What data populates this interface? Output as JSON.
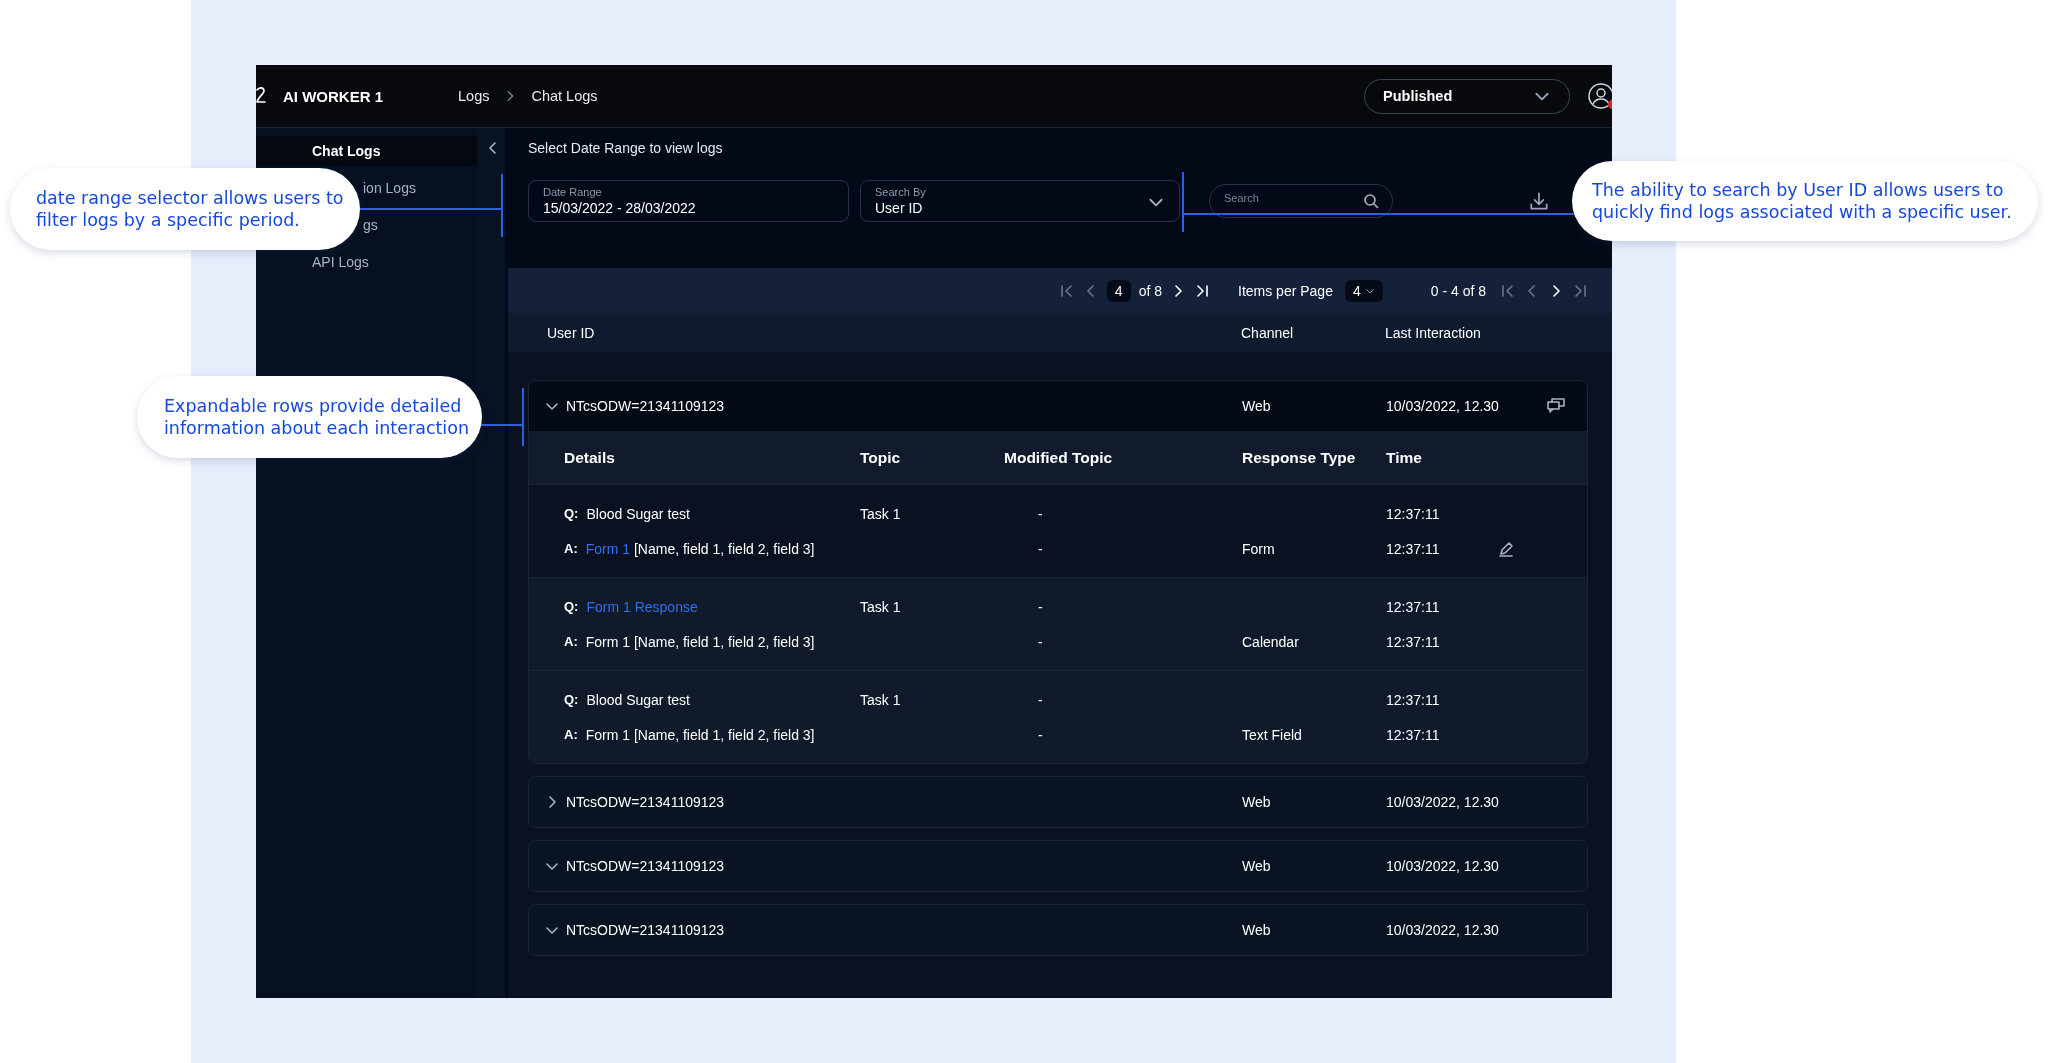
{
  "app": {
    "title": "AI WORKER 1",
    "breadcrumb": [
      "Logs",
      "Chat Logs"
    ],
    "status": "Published"
  },
  "sidebar": {
    "items": [
      {
        "label": "Chat Logs",
        "selected": true,
        "kind": "item"
      },
      {
        "label": "ion Logs",
        "selected": false,
        "kind": "cut"
      },
      {
        "label": "gs",
        "selected": false,
        "kind": "cut"
      },
      {
        "label": "API Logs",
        "selected": false,
        "kind": "item"
      }
    ]
  },
  "filters": {
    "heading": "Select Date Range to view logs",
    "date_range": {
      "label": "Date Range",
      "value": "15/03/2022 - 28/03/2022"
    },
    "search_by": {
      "label": "Search By",
      "value": "User ID"
    },
    "search": {
      "placeholder": "Search"
    }
  },
  "pagination": {
    "page": "4",
    "of": "of 8",
    "items_label": "Items per Page",
    "items_value": "4",
    "range": "0 - 4 of 8"
  },
  "table": {
    "columns": [
      "User ID",
      "Channel",
      "Last Interaction"
    ],
    "detail_columns": [
      "Details",
      "Topic",
      "Modified Topic",
      "Response Type",
      "Time"
    ],
    "rows": [
      {
        "user_id": "NTcsODW=21341109123",
        "channel": "Web",
        "last_interaction": "10/03/2022, 12.30",
        "expanded": true,
        "chat_icon": true,
        "groups": [
          {
            "selected": true,
            "lines": [
              {
                "label": "Q:",
                "parts": [
                  {
                    "text": "Blood Sugar test",
                    "link": false
                  }
                ],
                "topic": "Task 1",
                "modified": "-",
                "time": "12:37:11",
                "editable": false
              },
              {
                "label": "A:",
                "parts": [
                  {
                    "text": "Form 1",
                    "link": true
                  },
                  {
                    "text": " [Name, field 1, field 2, field 3]",
                    "link": false
                  }
                ],
                "modified": "-",
                "response_type": "Form",
                "time": "12:37:11",
                "editable": true
              }
            ]
          },
          {
            "selected": false,
            "lines": [
              {
                "label": "Q:",
                "parts": [
                  {
                    "text": "Form 1 Response",
                    "link": true
                  }
                ],
                "topic": "Task 1",
                "modified": "-",
                "time": "12:37:11",
                "editable": false
              },
              {
                "label": "A:",
                "parts": [
                  {
                    "text": "Form 1 [Name, field 1, field 2, field 3]",
                    "link": false
                  }
                ],
                "modified": "-",
                "response_type": "Calendar",
                "time": "12:37:11",
                "editable": false
              }
            ]
          },
          {
            "selected": false,
            "lines": [
              {
                "label": "Q:",
                "parts": [
                  {
                    "text": "Blood Sugar test",
                    "link": false
                  }
                ],
                "topic": "Task 1",
                "modified": "-",
                "time": "12:37:11",
                "editable": false
              },
              {
                "label": "A:",
                "parts": [
                  {
                    "text": "Form 1 [Name, field 1, field 2, field 3]",
                    "link": false
                  }
                ],
                "modified": "-",
                "response_type": "Text Field",
                "time": "12:37:11",
                "editable": false
              }
            ]
          }
        ]
      },
      {
        "user_id": "NTcsODW=21341109123",
        "channel": "Web",
        "last_interaction": "10/03/2022, 12.30",
        "expanded": false,
        "chat_icon": false
      },
      {
        "user_id": "NTcsODW=21341109123",
        "channel": "Web",
        "last_interaction": "10/03/2022, 12.30",
        "expanded": true,
        "chat_icon": false
      },
      {
        "user_id": "NTcsODW=21341109123",
        "channel": "Web",
        "last_interaction": "10/03/2022, 12.30",
        "expanded": true,
        "chat_icon": false
      }
    ]
  },
  "callouts": [
    {
      "text": "date range selector allows users to filter logs by a specific period."
    },
    {
      "text": "The ability to search by User ID allows users to quickly find logs associated with a specific user."
    },
    {
      "text": "Expandable rows provide detailed information about each interaction"
    }
  ]
}
